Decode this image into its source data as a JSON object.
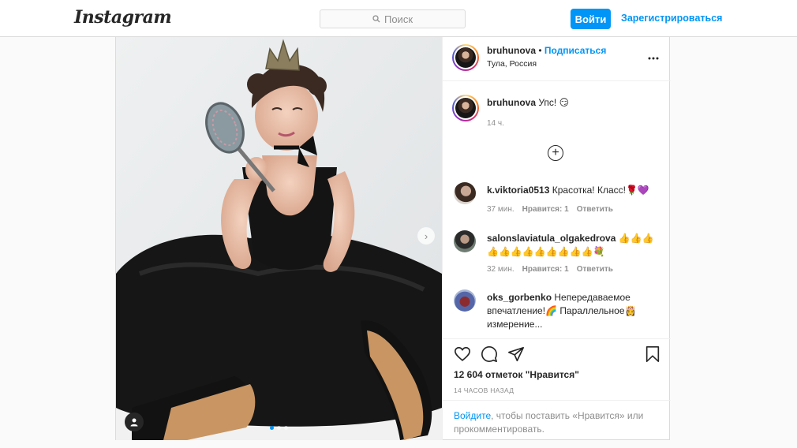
{
  "header": {
    "logo": "Instagram",
    "search_placeholder": "Поиск",
    "login_label": "Войти",
    "register_label": "Зарегистрироваться"
  },
  "post": {
    "author": "bruhunova",
    "follow_label": "Подписаться",
    "separator": "•",
    "location": "Тула, Россия",
    "more_label": "•••",
    "caption_user": "bruhunova",
    "caption_text": "Упс! 😏",
    "caption_time": "14 ч.",
    "load_more_label": "+",
    "slide_count": 3,
    "active_slide": 1
  },
  "comments": [
    {
      "user": "k.viktoria0513",
      "text": "Красотка! Класс!🌹💜",
      "time": "37 мин.",
      "likes": "Нравится: 1",
      "reply": "Ответить"
    },
    {
      "user": "salonslaviatula_olgakedrova",
      "text": "👍👍👍👍👍👍👍👍👍👍👍👍💐",
      "time": "32 мин.",
      "likes": "Нравится: 1",
      "reply": "Ответить"
    },
    {
      "user": "oks_gorbenko",
      "text": "Непередаваемое впечатление!🌈 Параллельное👸 измерение...",
      "time": "",
      "likes": "",
      "reply": ""
    }
  ],
  "footer": {
    "likes": "12 604 отметок \"Нравится\"",
    "posted": "14 ЧАСОВ НАЗАД",
    "login_link": "Войдите",
    "login_rest": ", чтобы поставить «Нравится» или прокомментировать."
  },
  "colors": {
    "accent": "#0095f6",
    "text": "#262626",
    "muted": "#8e8e8e",
    "border": "#dbdbdb"
  }
}
